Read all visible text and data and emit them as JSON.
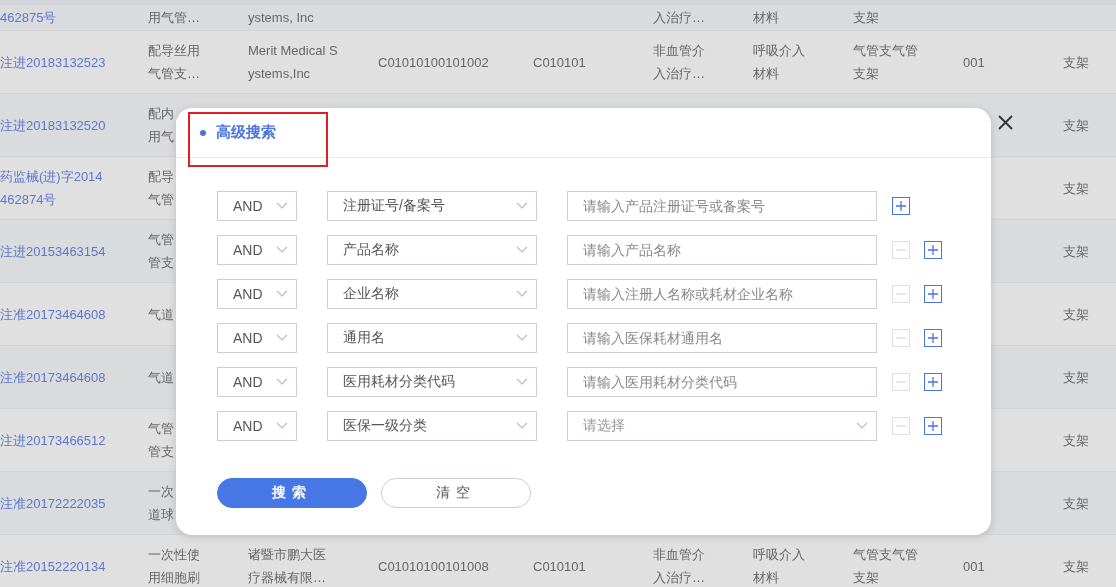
{
  "table": {
    "rows": [
      {
        "column_1": [
          "462875号"
        ],
        "column_2": [
          "用气管…"
        ],
        "column_3": [
          "ystems, Inc"
        ],
        "column_6": [
          "入治疗…"
        ],
        "column_7": [
          "材料"
        ],
        "column_8": [
          "支架"
        ]
      },
      {
        "column_1": [
          "注进20183132523"
        ],
        "column_2": [
          "配导丝用",
          "气管支…"
        ],
        "column_3": [
          "Merit Medical S",
          "ystems,Inc"
        ],
        "column_4": [
          "C01010100101002"
        ],
        "column_5": [
          "C010101"
        ],
        "column_6": [
          "非血管介",
          "入治疗…"
        ],
        "column_7": [
          "呼吸介入",
          "材料"
        ],
        "column_8": [
          "气管支气管",
          "支架"
        ],
        "column_9": [
          "001"
        ],
        "column_10": [
          "支架"
        ]
      },
      {
        "column_1": [
          "注进20183132520"
        ],
        "column_2": [
          "配内",
          "用气"
        ],
        "column_10": [
          "支架"
        ]
      },
      {
        "column_1": [
          "药监械(进)字2014",
          "462874号"
        ],
        "column_2": [
          "配导",
          "气管"
        ],
        "column_10": [
          "支架"
        ]
      },
      {
        "column_1": [
          "注进20153463154"
        ],
        "column_2": [
          "气管",
          "管支"
        ],
        "column_10": [
          "支架"
        ]
      },
      {
        "column_1": [
          "注准20173464608"
        ],
        "column_2": [
          "气道"
        ],
        "column_10": [
          "支架"
        ]
      },
      {
        "column_1": [
          "注准20173464608"
        ],
        "column_2": [
          "气道"
        ],
        "column_10": [
          "支架"
        ]
      },
      {
        "column_1": [
          "注进20173466512"
        ],
        "column_2": [
          "气管",
          "管支"
        ],
        "column_10": [
          "支架"
        ]
      },
      {
        "column_1": [
          "注准20172222035"
        ],
        "column_2": [
          "一次",
          "道球"
        ],
        "column_10": [
          "支架"
        ]
      },
      {
        "column_1": [
          "注准20152220134"
        ],
        "column_2": [
          "一次性使",
          "用细胞刷"
        ],
        "column_3": [
          "诸暨市鹏大医",
          "疗器械有限…"
        ],
        "column_4": [
          "C01010100101008"
        ],
        "column_5": [
          "C010101"
        ],
        "column_6": [
          "非血管介",
          "入治疗…"
        ],
        "column_7": [
          "呼吸介入",
          "材料"
        ],
        "column_8": [
          "气管支气管",
          "支架"
        ],
        "column_9": [
          "001"
        ],
        "column_10": [
          "支架"
        ]
      }
    ]
  },
  "dialog": {
    "title": "高级搜索",
    "highlighted": true,
    "conditions": [
      {
        "operator": "AND",
        "field": "注册证号/备案号",
        "kind": "input",
        "placeholder": "请输入产品注册证号或备案号",
        "removable": false
      },
      {
        "operator": "AND",
        "field": "产品名称",
        "kind": "input",
        "placeholder": "请输入产品名称",
        "removable": true
      },
      {
        "operator": "AND",
        "field": "企业名称",
        "kind": "input",
        "placeholder": "请输入注册人名称或耗材企业名称",
        "removable": true
      },
      {
        "operator": "AND",
        "field": "通用名",
        "kind": "input",
        "placeholder": "请输入医保耗材通用名",
        "removable": true
      },
      {
        "operator": "AND",
        "field": "医用耗材分类代码",
        "kind": "input",
        "placeholder": "请输入医用耗材分类代码",
        "removable": true
      },
      {
        "operator": "AND",
        "field": "医保一级分类",
        "kind": "select",
        "placeholder": "请选择",
        "removable": true
      }
    ],
    "buttons": [
      {
        "label": "搜索",
        "kind": "primary"
      },
      {
        "label": "清空",
        "kind": "secondary"
      }
    ]
  }
}
